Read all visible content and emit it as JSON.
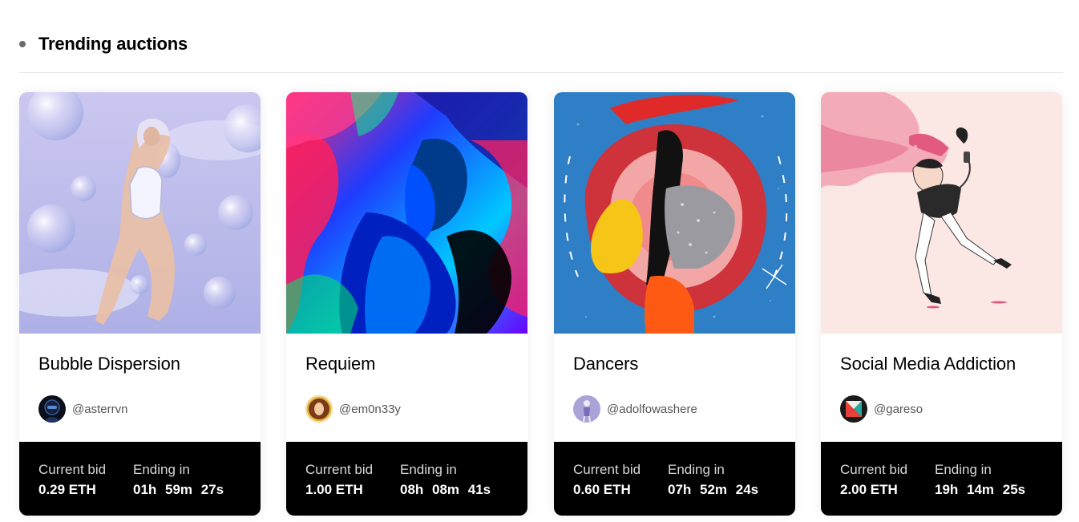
{
  "section": {
    "title": "Trending auctions"
  },
  "labels": {
    "current_bid": "Current bid",
    "ending_in": "Ending in"
  },
  "cards": [
    {
      "title": "Bubble Dispersion",
      "creator": "@asterrvn",
      "bid": "0.29 ETH",
      "ending": "01h 59m 27s"
    },
    {
      "title": "Requiem",
      "creator": "@em0n33y",
      "bid": "1.00 ETH",
      "ending": "08h 08m 41s"
    },
    {
      "title": "Dancers",
      "creator": "@adolfowashere",
      "bid": "0.60 ETH",
      "ending": "07h 52m 24s"
    },
    {
      "title": "Social Media Addiction",
      "creator": "@gareso",
      "bid": "2.00 ETH",
      "ending": "19h 14m 25s"
    }
  ]
}
